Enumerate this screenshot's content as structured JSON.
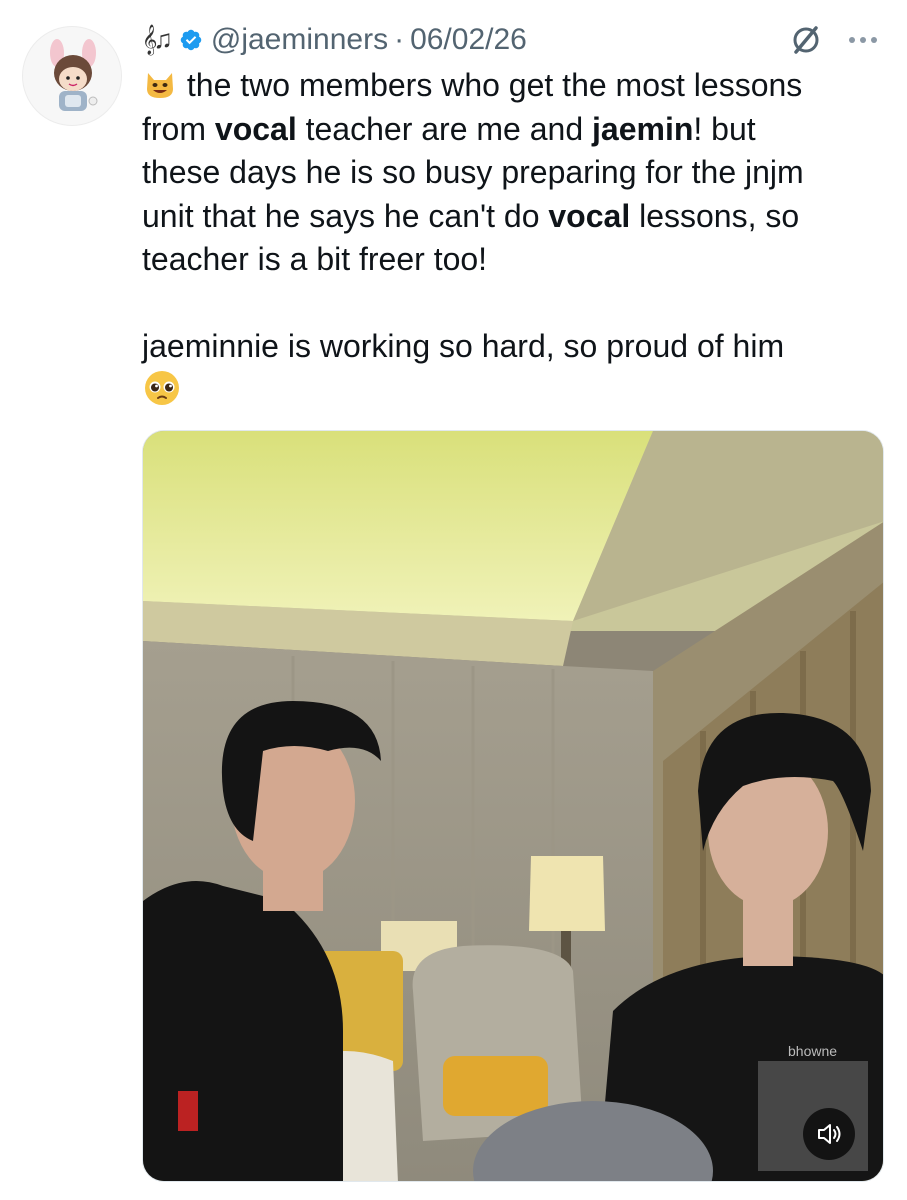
{
  "tweet": {
    "handle": "@jaeminners",
    "separator": "·",
    "date": "06/02/26",
    "name_emoji": "𝄞♫",
    "text": {
      "line1_pre": " the two members who get the most lessons",
      "line2_from": "from ",
      "bold_vocal_1": "vocal",
      "line2_mid": " teacher are me and ",
      "bold_jaemin": "jaemin",
      "line2_post": "! but",
      "line3": "these days he is so busy preparing for the jnjm",
      "line4_pre": "unit that he says he can't do ",
      "bold_vocal_2": "vocal",
      "line4_post": " lessons, so",
      "line5": "teacher is a bit freer too!",
      "line6": "jaeminnie is working so hard, so proud of him"
    }
  },
  "media": {
    "shirt_text": "bhowne"
  },
  "icons": {
    "verified": "verified-badge-icon",
    "grok": "grok-icon",
    "more": "more-options-icon",
    "volume": "volume-icon"
  },
  "colors": {
    "verified": "#1d9bf0",
    "meta_text": "#536471",
    "body_text": "#0f1419"
  }
}
